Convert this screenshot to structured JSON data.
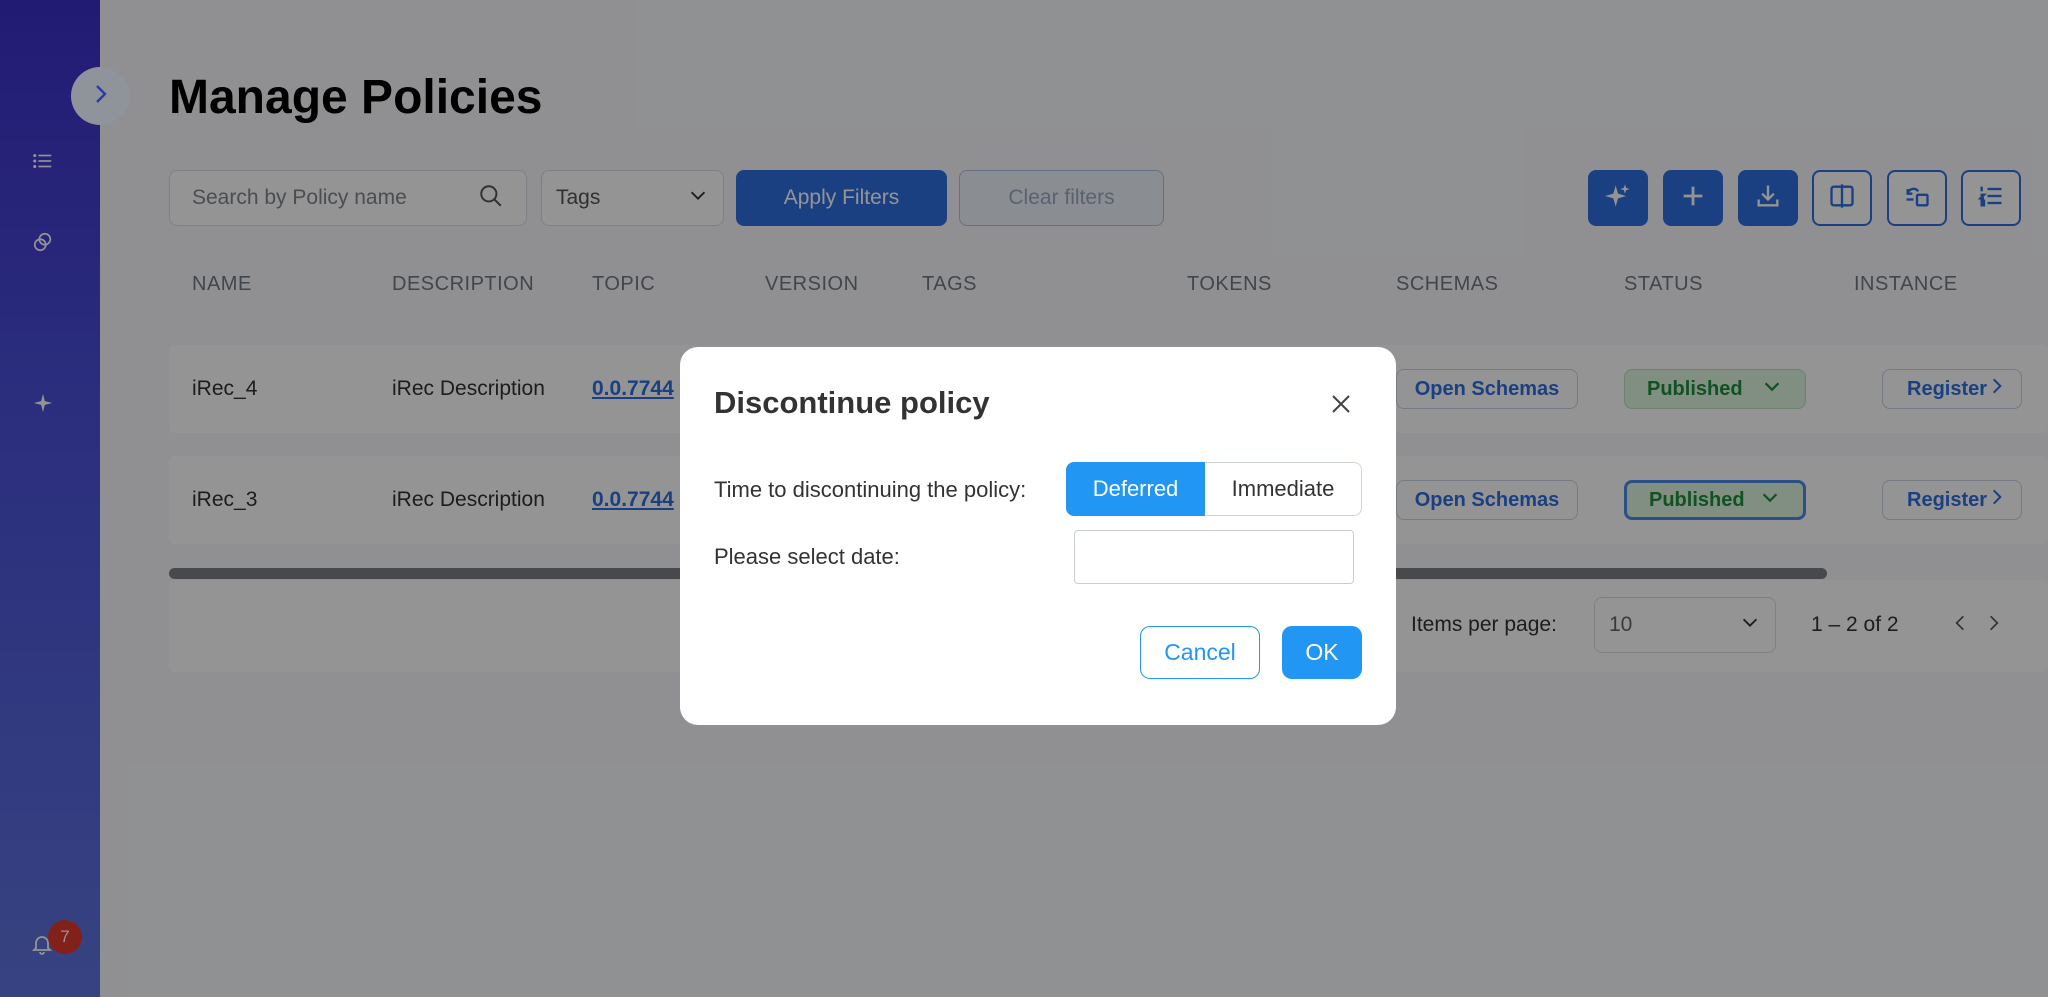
{
  "sidebar": {
    "notification_count": "7"
  },
  "page": {
    "title": "Manage Policies"
  },
  "filters": {
    "search_placeholder": "Search by Policy name",
    "tags_placeholder": "Tags",
    "apply_label": "Apply Filters",
    "clear_label": "Clear filters"
  },
  "table": {
    "columns": [
      "NAME",
      "DESCRIPTION",
      "TOPIC",
      "VERSION",
      "TAGS",
      "TOKENS",
      "SCHEMAS",
      "STATUS",
      "INSTANCE"
    ],
    "rows": [
      {
        "name": "iRec_4",
        "description": "iRec Description",
        "topic": "0.0.7744",
        "schemas": "Open Schemas",
        "status": "Published",
        "instance": "Register"
      },
      {
        "name": "iRec_3",
        "description": "iRec Description",
        "topic": "0.0.7744",
        "schemas": "Open Schemas",
        "status": "Published",
        "instance": "Register"
      }
    ]
  },
  "pagination": {
    "items_per_page_label": "Items per page:",
    "items_per_page_value": "10",
    "range": "1 – 2 of 2"
  },
  "dialog": {
    "title": "Discontinue policy",
    "time_label": "Time to discontinuing the policy:",
    "option_deferred": "Deferred",
    "option_immediate": "Immediate",
    "date_label": "Please select date:",
    "date_value": "",
    "cancel_label": "Cancel",
    "ok_label": "OK"
  },
  "colors": {
    "primary": "#2f6fe0",
    "dialog_accent": "#2196f3",
    "status_green": "#1e8d3e",
    "badge_red": "#e0382d"
  }
}
